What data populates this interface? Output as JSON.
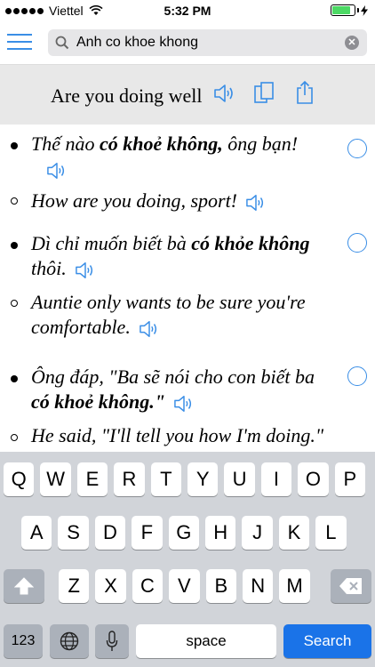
{
  "status": {
    "carrier": "Viettel",
    "time": "5:32 PM",
    "signal_icon": "signal-dots-icon",
    "wifi_icon": "wifi-icon",
    "battery_icon": "battery-icon",
    "charging_icon": "charging-icon"
  },
  "search": {
    "value": "Anh co khoe khong",
    "placeholder": ""
  },
  "header": {
    "phrase": "Are you doing well"
  },
  "sentences": [
    {
      "vi_pre": "Thế nào ",
      "vi_bold": "có khoẻ không,",
      "vi_post": " ông bạn!",
      "en": "How are you doing, sport!"
    },
    {
      "vi_pre": "Dì chỉ muốn biết bà ",
      "vi_bold": "có khỏe không",
      "vi_post": " thôi.",
      "en": "Auntie only wants to be sure you're comfortable."
    },
    {
      "vi_pre": "Ông đáp, \"Ba sẽ nói cho con biết ba ",
      "vi_bold": "có khoẻ không.\"",
      "vi_post": "",
      "en": "He said, \"I'll tell you how I'm doing.\""
    }
  ],
  "keyboard": {
    "row1": [
      "Q",
      "W",
      "E",
      "R",
      "T",
      "Y",
      "U",
      "I",
      "O",
      "P"
    ],
    "row2": [
      "A",
      "S",
      "D",
      "F",
      "G",
      "H",
      "J",
      "K",
      "L"
    ],
    "row3": [
      "Z",
      "X",
      "C",
      "V",
      "B",
      "N",
      "M"
    ],
    "numbers_label": "123",
    "space_label": "space",
    "search_label": "Search"
  },
  "colors": {
    "accent": "#3a8ee6",
    "search_key": "#1a73e8",
    "header_bg": "#e8e8e8",
    "keyboard_bg": "#d1d4d9"
  }
}
